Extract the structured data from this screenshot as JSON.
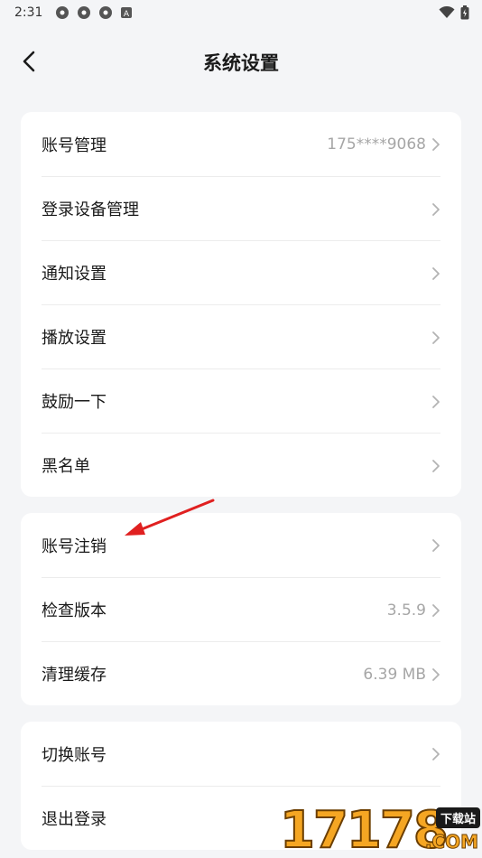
{
  "status_bar": {
    "time": "2:31",
    "left_icons": [
      "photo-app-icon",
      "photo-app-icon",
      "photo-app-icon",
      "a-badge-icon"
    ],
    "right_icons": [
      "wifi-icon",
      "battery-icon"
    ]
  },
  "header": {
    "title": "系统设置"
  },
  "groups": [
    {
      "rows": [
        {
          "label": "账号管理",
          "value": "175****9068"
        },
        {
          "label": "登录设备管理",
          "value": ""
        },
        {
          "label": "通知设置",
          "value": ""
        },
        {
          "label": "播放设置",
          "value": ""
        },
        {
          "label": "鼓励一下",
          "value": ""
        },
        {
          "label": "黑名单",
          "value": ""
        }
      ]
    },
    {
      "rows": [
        {
          "label": "账号注销",
          "value": ""
        },
        {
          "label": "检查版本",
          "value": "3.5.9"
        },
        {
          "label": "清理缓存",
          "value": "6.39 MB"
        }
      ]
    },
    {
      "rows": [
        {
          "label": "切换账号",
          "value": ""
        },
        {
          "label": "退出登录",
          "value": ""
        }
      ]
    }
  ],
  "annotation": {
    "color": "#e02020"
  },
  "watermark": {
    "number": "17178",
    "tag": "下载站",
    "suffix": ".COM"
  },
  "colors": {
    "background": "#f4f5f7",
    "card": "#ffffff",
    "secondary_text": "#a6a6a6"
  }
}
